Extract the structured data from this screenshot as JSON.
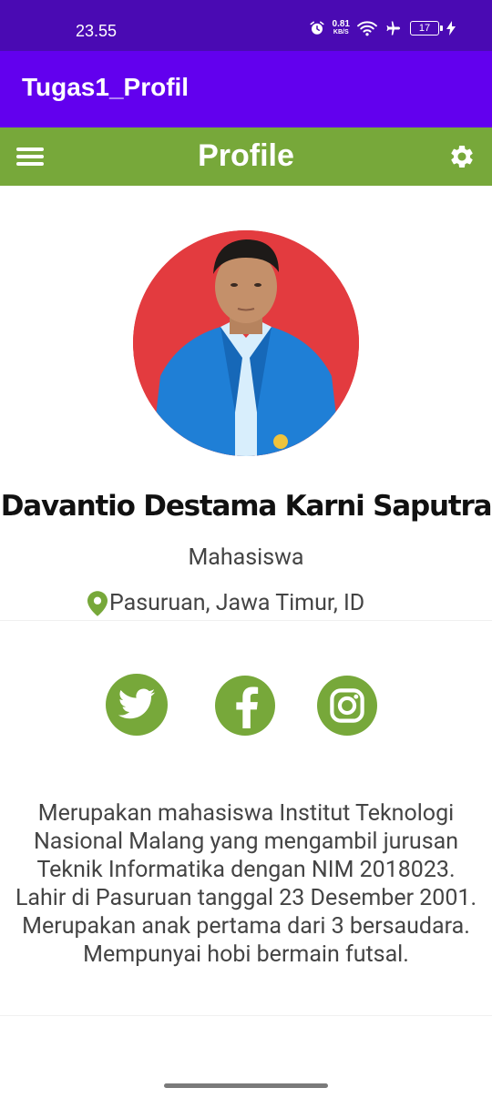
{
  "status_bar": {
    "time": "23.55",
    "net_speed": "0.81",
    "net_unit": "KB/S",
    "battery": "17"
  },
  "app_bar": {
    "title": "Tugas1_Profil"
  },
  "toolbar": {
    "title": "Profile",
    "icons": [
      "menu-icon",
      "gear-icon"
    ]
  },
  "profile": {
    "name": "Davantio Destama Karni Saputra",
    "role": "Mahasiswa",
    "location": "Pasuruan, Jawa Timur, ID",
    "bio": "Merupakan mahasiswa Institut Teknologi Nasional Malang yang mengambil jurusan Teknik Informatika dengan NIM 2018023. Lahir di Pasuruan tanggal 23 Desember 2001. Merupakan anak pertama dari 3 bersaudara. Mempunyai hobi bermain futsal."
  },
  "social": [
    "twitter-icon",
    "facebook-icon",
    "instagram-icon"
  ],
  "colors": {
    "status_bar": "#4a0ab3",
    "app_bar": "#6200ee",
    "toolbar": "#77a83a",
    "accent": "#77a83a",
    "avatar_bg": "#e33b3f"
  }
}
